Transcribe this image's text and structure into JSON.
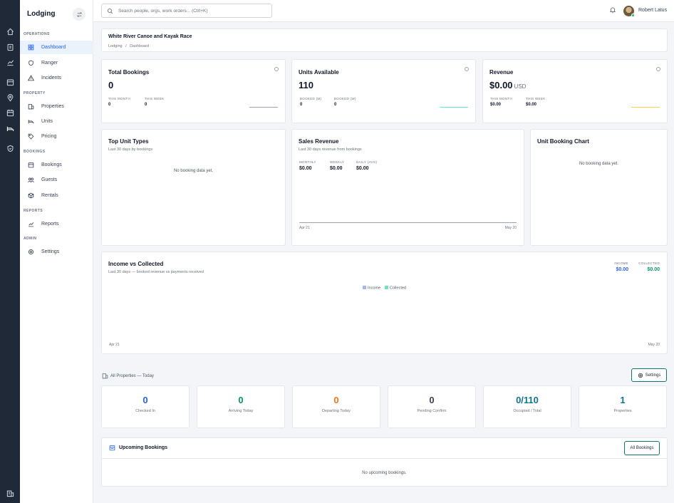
{
  "app": {
    "title": "Lodging"
  },
  "colors": {
    "accent": "#2563eb",
    "teal": "#0f766e",
    "green": "#059669",
    "orange": "#f97316",
    "sidebar_dark": "#1f2937"
  },
  "rail_icons": [
    "home-icon",
    "book-icon",
    "chart-icon",
    "calendar-icon",
    "map-pin-icon",
    "calendar-icon",
    "bed-icon",
    "shield-icon",
    "building-icon"
  ],
  "sidebar": {
    "sections": [
      {
        "label": "OPERATIONS"
      },
      {
        "label": "PROPERTY"
      },
      {
        "label": "BOOKINGS"
      },
      {
        "label": "REPORTS"
      },
      {
        "label": "ADMIN"
      }
    ],
    "items": [
      {
        "label": "Dashboard",
        "icon": "grid-icon",
        "active": true
      },
      {
        "label": "Ranger",
        "icon": "shield-icon"
      },
      {
        "label": "Incidents",
        "icon": "warning-icon"
      },
      {
        "label": "Properties",
        "icon": "building-icon"
      },
      {
        "label": "Units",
        "icon": "bed-icon"
      },
      {
        "label": "Pricing",
        "icon": "tag-icon"
      },
      {
        "label": "Bookings",
        "icon": "calendar-icon"
      },
      {
        "label": "Guests",
        "icon": "users-icon"
      },
      {
        "label": "Rentals",
        "icon": "box-icon"
      },
      {
        "label": "Reports",
        "icon": "chart-icon"
      },
      {
        "label": "Settings",
        "icon": "gear-icon"
      }
    ]
  },
  "topbar": {
    "search_placeholder": "Search people, orgs, work orders... (Ctrl+K)",
    "user_name": "Robert Latus"
  },
  "header": {
    "title": "White River Canoe and Kayak Race",
    "breadcrumb": [
      "Lodging",
      "/",
      "Dashboard"
    ]
  },
  "kpis": {
    "bookings": {
      "title": "Total Bookings",
      "value": "0",
      "sub1_label": "THIS MONTH",
      "sub1_value": "0",
      "sub2_label": "THIS WEEK",
      "sub2_value": "0"
    },
    "units": {
      "title": "Units Available",
      "value": "110",
      "sub1_label": "BOOKED (M)",
      "sub1_value": "0",
      "sub2_label": "BOOKED (W)",
      "sub2_value": "0"
    },
    "revenue": {
      "title": "Revenue",
      "value": "$0.00",
      "unit": "USD",
      "sub1_label": "THIS MONTH",
      "sub1_value": "$0.00",
      "sub2_label": "THIS WEEK",
      "sub2_value": "$0.00"
    }
  },
  "top_units": {
    "title": "Top Unit Types",
    "subtitle": "Last 30 days by bookings",
    "empty": "No booking data yet."
  },
  "sales": {
    "title": "Sales Revenue",
    "subtitle": "Last 30 days revenue from bookings",
    "monthly_label": "MONTHLY",
    "monthly_value": "$0.00",
    "weekly_label": "WEEKLY",
    "weekly_value": "$0.00",
    "daily_label": "DAILY (AVG)",
    "daily_value": "$0.00",
    "x_start": "Apr 21",
    "x_end": "May 20"
  },
  "unit_chart": {
    "title": "Unit Booking Chart",
    "empty": "No booking data yet."
  },
  "income": {
    "title": "Income vs Collected",
    "subtitle": "Last 30 days — booked revenue vs payments received",
    "income_label": "INCOME",
    "income_value": "$0.00",
    "collected_label": "COLLECTED",
    "collected_value": "$0.00",
    "legend_income": "Income",
    "legend_collected": "Collected",
    "x_start": "Apr 21",
    "x_end": "May 20"
  },
  "properties": {
    "section_label": "All Properties — Today",
    "settings_label": "Settings",
    "stats": [
      {
        "value": "0",
        "label": "Checked In",
        "color": "#2563eb"
      },
      {
        "value": "0",
        "label": "Arriving Today",
        "color": "#059669"
      },
      {
        "value": "0",
        "label": "Departing Today",
        "color": "#f97316"
      },
      {
        "value": "0",
        "label": "Pending Confirm",
        "color": "#374151"
      },
      {
        "value": "0/110",
        "label": "Occupied / Total",
        "color": "#0e7490"
      },
      {
        "value": "1",
        "label": "Properties",
        "color": "#0e7490"
      }
    ]
  },
  "upcoming": {
    "title": "Upcoming Bookings",
    "button": "All Bookings",
    "empty": "No upcoming bookings."
  }
}
